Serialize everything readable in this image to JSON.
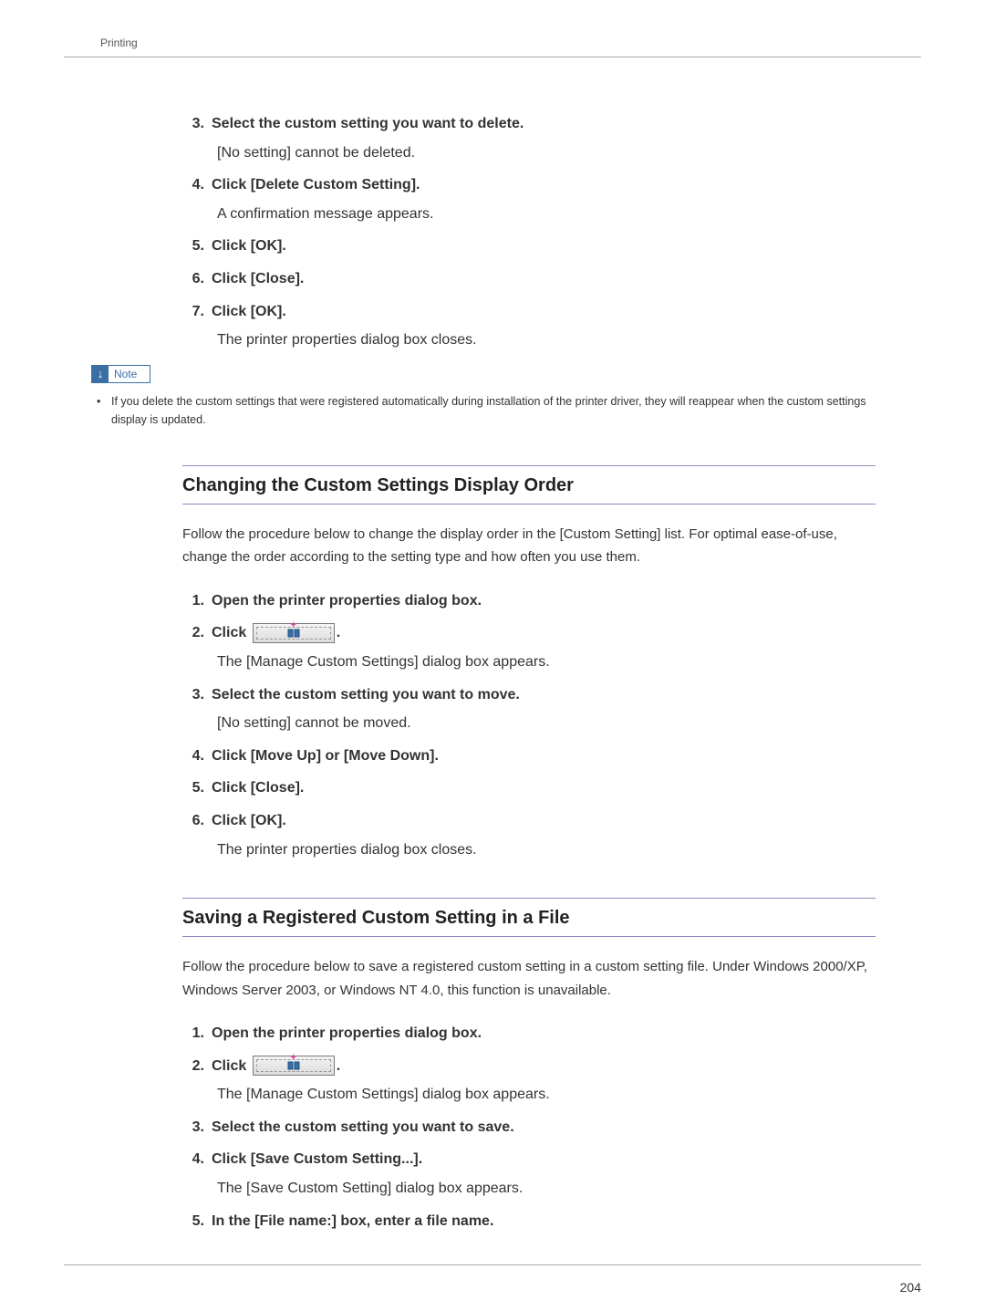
{
  "header": {
    "section_title": "Printing"
  },
  "page_number": "204",
  "note_label": "Note",
  "top_steps": [
    {
      "num": "3.",
      "bold": "Select the custom setting you want to delete.",
      "detail": "[No setting] cannot be deleted."
    },
    {
      "num": "4.",
      "bold": "Click [Delete Custom Setting].",
      "detail": "A confirmation message appears."
    },
    {
      "num": "5.",
      "bold": "Click [OK]."
    },
    {
      "num": "6.",
      "bold": "Click [Close]."
    },
    {
      "num": "7.",
      "bold": "Click [OK].",
      "detail": "The printer properties dialog box closes."
    }
  ],
  "note_text": "If you delete the custom settings that were registered automatically during installation of the printer driver, they will reappear when the custom settings display is updated.",
  "section1": {
    "title": "Changing the Custom Settings Display Order",
    "intro": "Follow the procedure below to change the display order in the [Custom Setting] list. For optimal ease-of-use, change the order according to the setting type and how often you use them.",
    "steps": [
      {
        "num": "1.",
        "bold": "Open the printer properties dialog box."
      },
      {
        "num": "2.",
        "bold_pre": "Click ",
        "has_icon": true,
        "bold_post": ".",
        "detail": "The [Manage Custom Settings] dialog box appears."
      },
      {
        "num": "3.",
        "bold": "Select the custom setting you want to move.",
        "detail": "[No setting] cannot be moved."
      },
      {
        "num": "4.",
        "bold": "Click [Move Up] or [Move Down]."
      },
      {
        "num": "5.",
        "bold": "Click [Close]."
      },
      {
        "num": "6.",
        "bold": "Click [OK].",
        "detail": "The printer properties dialog box closes."
      }
    ]
  },
  "section2": {
    "title": "Saving a Registered Custom Setting in a File",
    "intro": "Follow the procedure below to save a registered custom setting in a custom setting file. Under Windows 2000/XP, Windows Server 2003, or Windows NT 4.0, this function is unavailable.",
    "steps": [
      {
        "num": "1.",
        "bold": "Open the printer properties dialog box."
      },
      {
        "num": "2.",
        "bold_pre": "Click ",
        "has_icon": true,
        "bold_post": ".",
        "detail": "The [Manage Custom Settings] dialog box appears."
      },
      {
        "num": "3.",
        "bold": "Select the custom setting you want to save."
      },
      {
        "num": "4.",
        "bold": "Click [Save Custom Setting...].",
        "detail": "The [Save Custom Setting] dialog box appears."
      },
      {
        "num": "5.",
        "bold": "In the [File name:] box, enter a file name."
      }
    ]
  }
}
